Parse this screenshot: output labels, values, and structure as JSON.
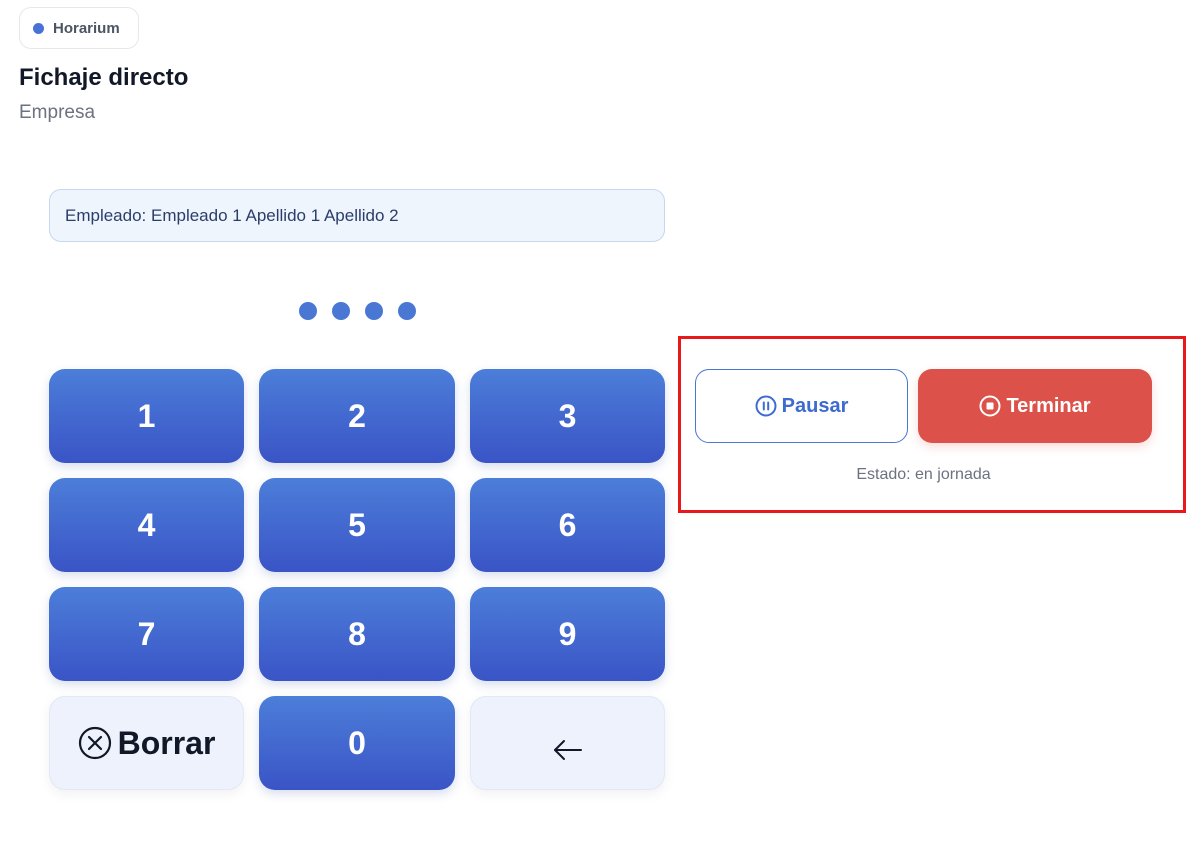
{
  "app": {
    "name": "Horarium",
    "accent_color": "#4a72d6"
  },
  "header": {
    "title": "Fichaje directo",
    "subtitle": "Empresa"
  },
  "employee": {
    "text": "Empleado: Empleado 1 Apellido 1 Apellido 2"
  },
  "pin": {
    "entered_count": 4
  },
  "keypad": {
    "keys": [
      "1",
      "2",
      "3",
      "4",
      "5",
      "6",
      "7",
      "8",
      "9"
    ],
    "clear_label": "Borrar",
    "clear_icon": "circle-x-icon",
    "zero": "0",
    "backspace_icon": "arrow-left-icon",
    "key_color": "#3f63cd"
  },
  "actions": {
    "pause_label": "Pausar",
    "pause_icon": "pause-circle-icon",
    "end_label": "Terminar",
    "end_icon": "stop-circle-icon",
    "end_color": "#dc524a",
    "highlight_color": "#e8191b"
  },
  "status": {
    "text": "Estado: en jornada"
  }
}
